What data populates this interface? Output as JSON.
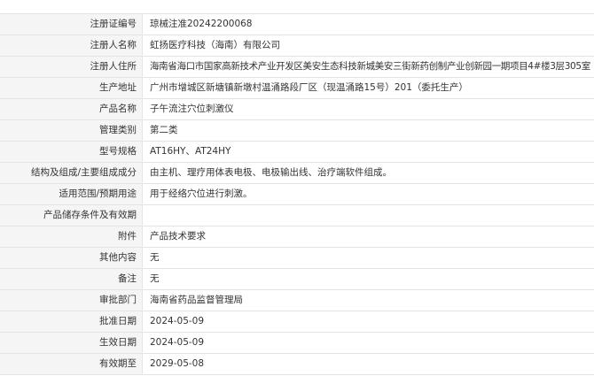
{
  "record": {
    "rows": [
      {
        "label": "注册证编号",
        "value": "琼械注准20242200068"
      },
      {
        "label": "注册人名称",
        "value": "虹扬医疗科技（海南）有限公司"
      },
      {
        "label": "注册人住所",
        "value": "海南省海口市国家高新技术产业开发区美安生态科技新城美安三街新药创制产业创新园一期项目4#楼3层305室"
      },
      {
        "label": "生产地址",
        "value": "广州市增城区新塘镇新墩村温涌路段厂区（现温涌路15号）201（委托生产）"
      },
      {
        "label": "产品名称",
        "value": "子午流注穴位刺激仪"
      },
      {
        "label": "管理类别",
        "value": "第二类"
      },
      {
        "label": "型号规格",
        "value": "AT16HY、AT24HY"
      },
      {
        "label": "结构及组成/主要组成成分",
        "value": "由主机、理疗用体表电极、电极输出线、治疗端软件组成。"
      },
      {
        "label": "适用范围/预期用途",
        "value": "用于经络穴位进行刺激。"
      },
      {
        "label": "产品储存条件及有效期",
        "value": ""
      },
      {
        "label": "附件",
        "value": "产品技术要求"
      },
      {
        "label": "其他内容",
        "value": "无"
      },
      {
        "label": "备注",
        "value": "无"
      },
      {
        "label": "审批部门",
        "value": "海南省药品监督管理局"
      },
      {
        "label": "批准日期",
        "value": "2024-05-09"
      },
      {
        "label": "生效日期",
        "value": "2024-05-09"
      },
      {
        "label": "有效期至",
        "value": "2029-05-08"
      }
    ]
  }
}
